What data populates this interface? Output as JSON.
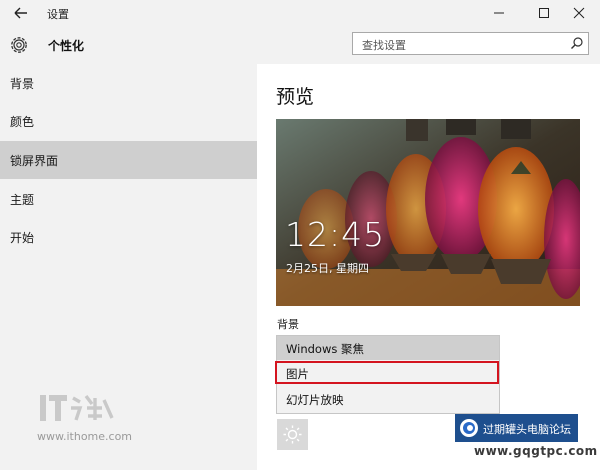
{
  "window": {
    "title": "设置",
    "back_icon": "arrow-left-icon",
    "controls": [
      "minimize-icon",
      "maximize-icon",
      "close-icon"
    ]
  },
  "header": {
    "icon": "gear-icon",
    "title": "个性化",
    "search_placeholder": "查找设置"
  },
  "sidebar": {
    "items": [
      {
        "label": "背景",
        "active": false
      },
      {
        "label": "颜色",
        "active": false
      },
      {
        "label": "锁屏界面",
        "active": true
      },
      {
        "label": "主题",
        "active": false
      },
      {
        "label": "开始",
        "active": false
      }
    ]
  },
  "main": {
    "title": "预览",
    "preview": {
      "time": "12:45",
      "date": "2月25日, 星期四"
    },
    "background_label": "背景",
    "background_options": [
      {
        "label": "Windows 聚焦",
        "selected": true
      },
      {
        "label": "图片",
        "selected": false,
        "highlighted": true
      },
      {
        "label": "幻灯片放映",
        "selected": false
      }
    ],
    "app_icon": "sun-icon"
  },
  "watermarks": {
    "left_url": "www.ithome.com",
    "badge_text": "过期罐头电脑论坛",
    "site": "www.gqgtpc.com"
  },
  "colors": {
    "chrome_bg": "#f2f2f2",
    "selected_bg": "#cfcfcf",
    "highlight_border": "#d4141f",
    "badge_bg": "#1e4f8e"
  }
}
